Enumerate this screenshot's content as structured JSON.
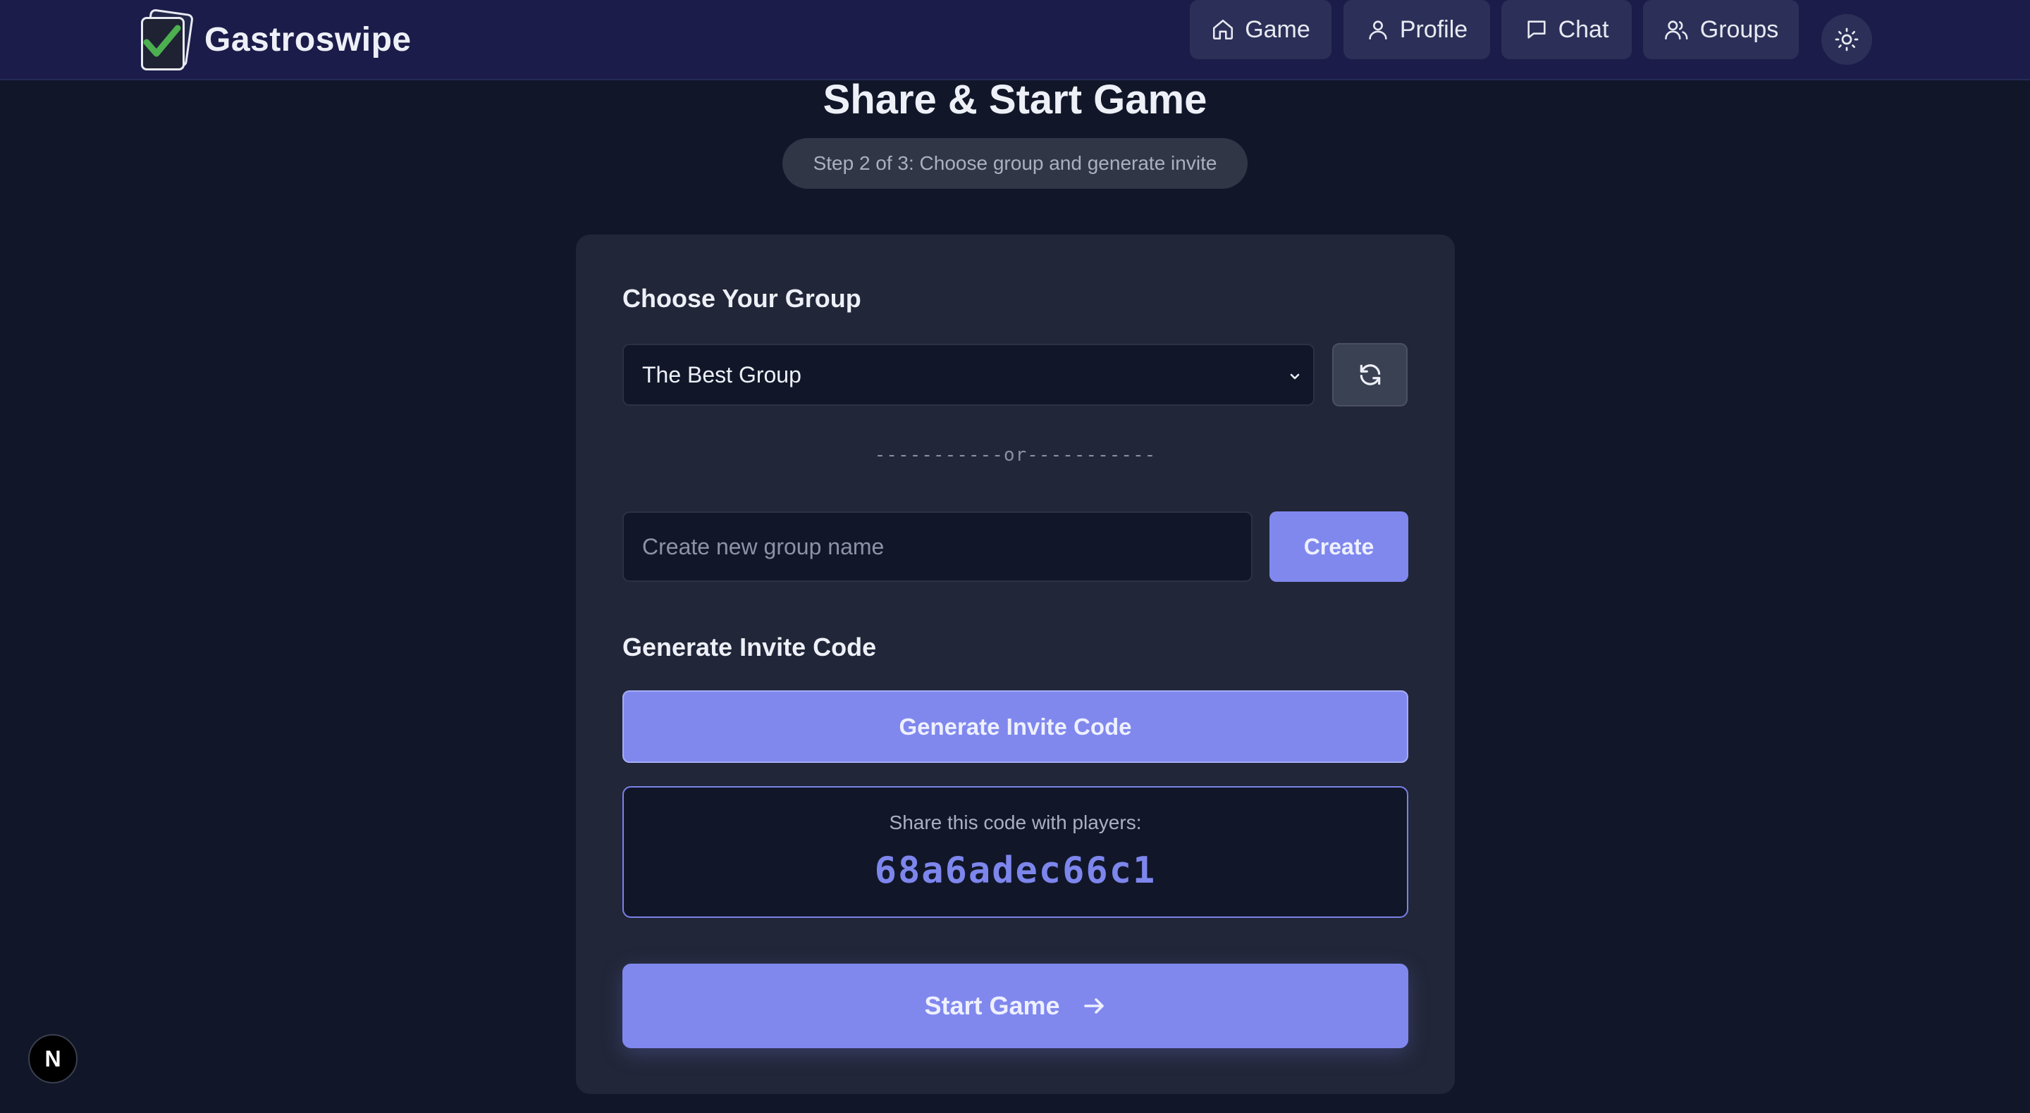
{
  "app": {
    "name": "Gastroswipe"
  },
  "nav": {
    "items": [
      {
        "label": "Game",
        "icon": "home-icon"
      },
      {
        "label": "Profile",
        "icon": "user-icon"
      },
      {
        "label": "Chat",
        "icon": "chat-icon"
      },
      {
        "label": "Groups",
        "icon": "users-icon"
      }
    ],
    "theme_toggle_icon": "sun-icon"
  },
  "page": {
    "title": "Share & Start Game",
    "step": "Step 2 of 3: Choose group and generate invite"
  },
  "group_section": {
    "heading": "Choose Your Group",
    "selected_group": "The Best Group",
    "refresh_icon": "refresh-icon",
    "divider": "-----------or-----------",
    "new_group_placeholder": "Create new group name",
    "new_group_value": "",
    "create_label": "Create"
  },
  "invite_section": {
    "heading": "Generate Invite Code",
    "generate_label": "Generate Invite Code",
    "share_caption": "Share this code with players:",
    "code": "68a6adec66c1"
  },
  "actions": {
    "start_label": "Start Game"
  },
  "badge": {
    "letter": "N"
  },
  "colors": {
    "background": "#111729",
    "header": "#1c1c4a",
    "card": "#212638",
    "accent": "#8088ee",
    "code_text": "#7d86ec",
    "logo_check": "#4caf50"
  }
}
